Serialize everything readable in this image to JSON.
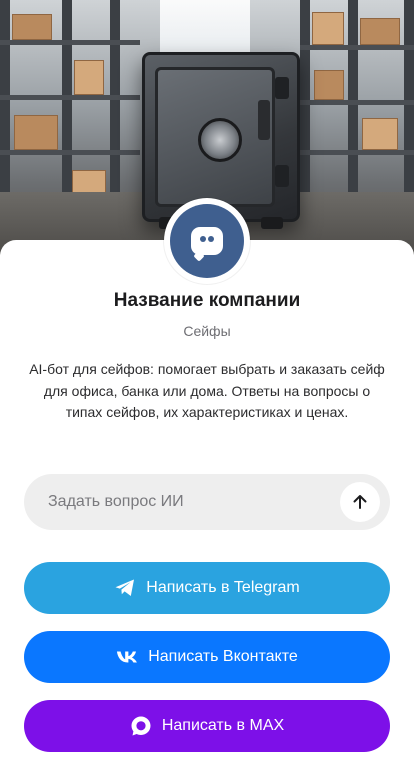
{
  "company": {
    "name": "Название компании",
    "category": "Сейфы",
    "description": "AI-бот для сейфов: помогает выбрать и заказать сейф для офиса, банка или дома. Ответы на вопросы о типах сейфов, их характеристиках и ценах."
  },
  "ask": {
    "placeholder": "Задать вопрос ИИ",
    "value": ""
  },
  "buttons": {
    "telegram": "Написать в Telegram",
    "vk": "Написать Вконтакте",
    "max": "Написать в MAX"
  },
  "icons": {
    "avatar": "bot-chat-icon",
    "send": "arrow-up-icon",
    "telegram": "telegram-plane-icon",
    "vk": "vk-logo-icon",
    "max": "max-chat-icon"
  },
  "colors": {
    "avatar_bg": "#3f5f8f",
    "input_bg": "#eeeeee",
    "telegram": "#2aa3e0",
    "vk": "#0a77ff",
    "max": "#7d10e8"
  }
}
